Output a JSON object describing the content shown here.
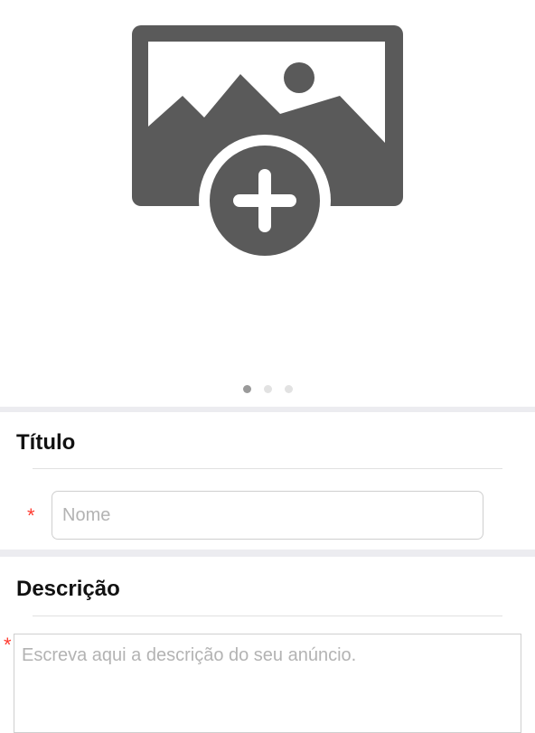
{
  "carousel": {
    "add_photo_icon": "image-add-icon",
    "dot_count": 3,
    "active_index": 0
  },
  "titulo": {
    "heading": "Título",
    "name_placeholder": "Nome",
    "name_value": "",
    "required_mark": "*"
  },
  "descricao": {
    "heading": "Descrição",
    "placeholder": "Escreva aqui a descrição do seu anúncio.",
    "value": "",
    "required_mark": "*"
  },
  "colors": {
    "icon": "#5a5a5a",
    "required": "#ff3b30",
    "separator": "#ececf0"
  }
}
